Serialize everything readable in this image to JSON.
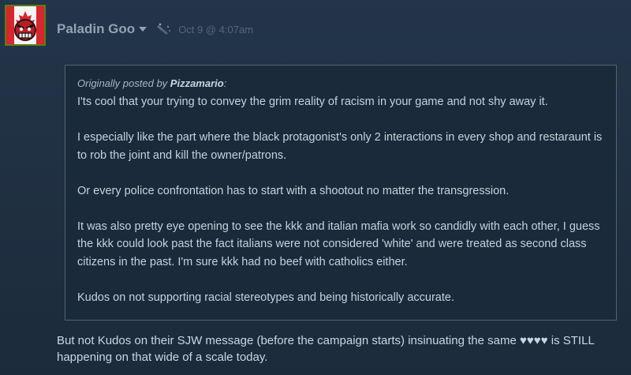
{
  "post": {
    "author": "Paladin Goo",
    "timestamp": "Oct 9 @ 4:07am",
    "avatar_icon": "angry-face-canada-flag-avatar",
    "badge_icon": "game-award-badge-icon",
    "quote": {
      "prefix": "Originally posted by",
      "quoted_author": "Pizzamario",
      "suffix": ":",
      "paragraphs": [
        "I'ts cool that your trying to convey the grim reality of racism in your game and not shy away it.",
        "I especially like the part where the black protagonist's only 2 interactions in every shop and restaraunt is to rob the joint and kill the owner/patrons.",
        "Or every police confrontation has to start with a shootout no matter the transgression.",
        "It was also pretty eye opening to see the kkk and italian mafia work so candidly with each other, I guess the kkk could look past the fact italians were not considered 'white' and were treated as second class citizens in the past. I'm sure kkk had no beef with catholics either.",
        "Kudos on not supporting racial stereotypes and being historically accurate."
      ]
    },
    "reply_text": "But not Kudos on their SJW message (before the campaign starts) insinuating the same ♥♥♥♥ is STILL happening on that wide of a scale today."
  },
  "colors": {
    "background": "#1e2d3d",
    "author": "#8fa3b4",
    "timestamp": "#52677a",
    "quote_border": "#4f637a",
    "avatar_border": "#5c7e10"
  }
}
